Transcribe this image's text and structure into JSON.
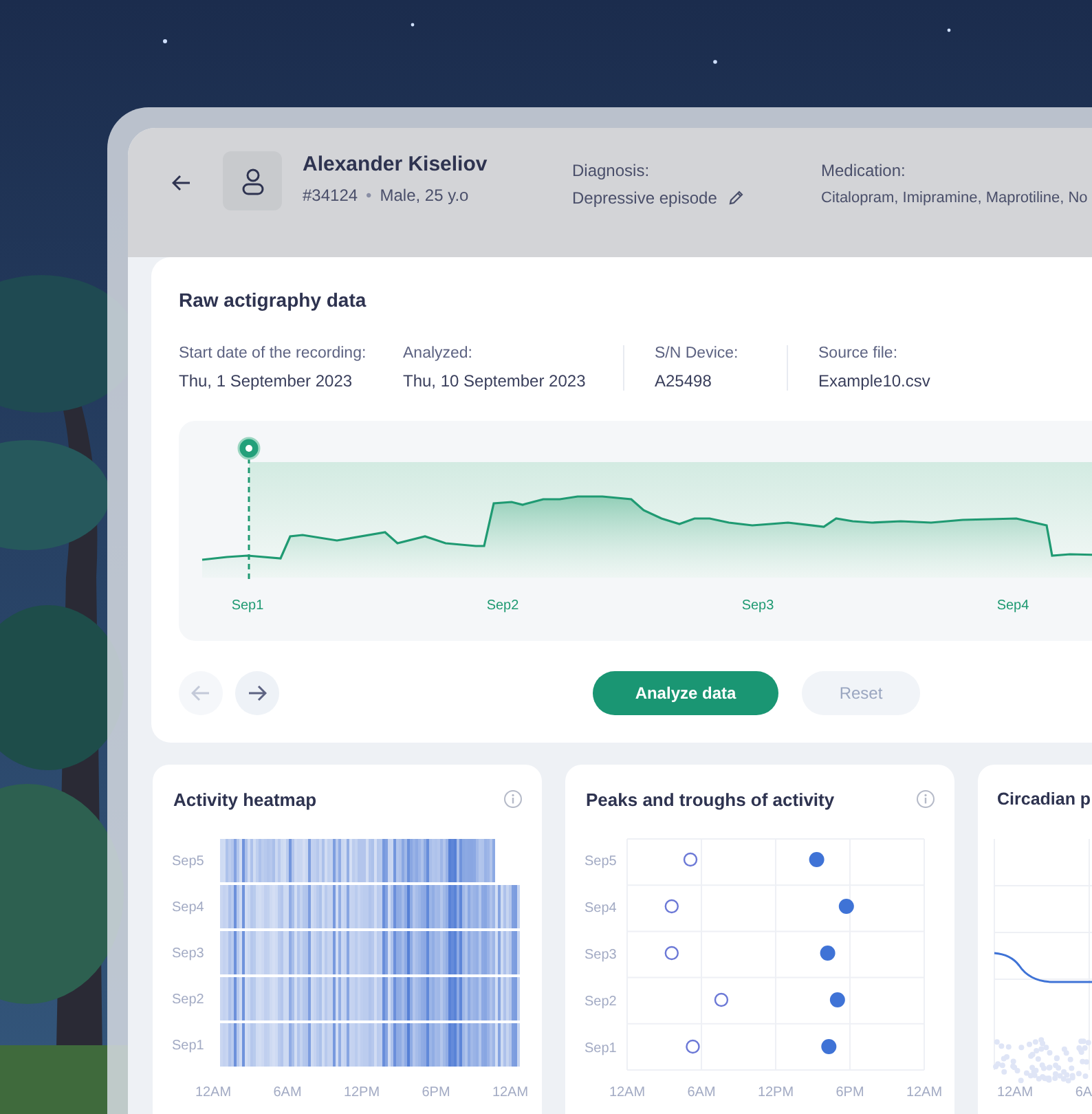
{
  "patient": {
    "name": "Alexander Kiseliov",
    "id": "#34124",
    "separator": "•",
    "details": "Male, 25 y.o"
  },
  "diagnosis": {
    "label": "Diagnosis:",
    "value": "Depressive episode"
  },
  "medication": {
    "label": "Medication:",
    "value": "Citalopram, Imipramine, Maprotiline, No"
  },
  "raw": {
    "title": "Raw actigraphy data",
    "meta": [
      {
        "label": "Start date of the recording:",
        "value": "Thu, 1 September 2023",
        "divider": false
      },
      {
        "label": "Analyzed:",
        "value": "Thu, 10 September 2023",
        "divider": false
      },
      {
        "label": "S/N Device:",
        "value": "A25498",
        "divider": true
      },
      {
        "label": "Source file:",
        "value": "Example10.csv",
        "divider": true
      }
    ],
    "x_labels": [
      "Sep1",
      "Sep2",
      "Sep3",
      "Sep4"
    ],
    "nav": [
      {
        "kind": "prev",
        "disabled": true
      },
      {
        "kind": "next",
        "disabled": false
      }
    ],
    "buttons": [
      {
        "label": "Analyze data",
        "kind": "primary"
      },
      {
        "label": "Reset",
        "kind": "secondary"
      }
    ]
  },
  "heatmap": {
    "title": "Activity heatmap",
    "rows": [
      "Sep5",
      "Sep4",
      "Sep3",
      "Sep2",
      "Sep1"
    ],
    "x_labels": [
      "12AM",
      "6AM",
      "12PM",
      "6PM",
      "12AM"
    ]
  },
  "peaks": {
    "title": "Peaks and troughs of activity",
    "rows": [
      "Sep5",
      "Sep4",
      "Sep3",
      "Sep2",
      "Sep1"
    ],
    "x_labels": [
      "12AM",
      "6AM",
      "12PM",
      "6PM",
      "12AM"
    ]
  },
  "circadian": {
    "title": "Circadian p",
    "x_labels": [
      "12AM",
      "6A"
    ]
  }
}
